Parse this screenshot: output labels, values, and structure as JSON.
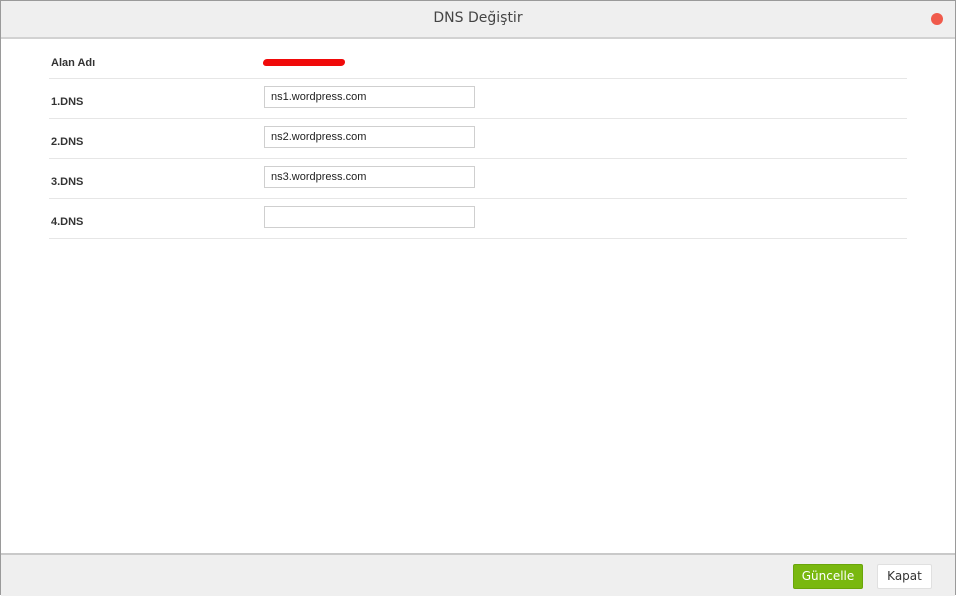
{
  "dialog": {
    "title": "DNS Değiştir"
  },
  "form": {
    "domain_label": "Alan Adı",
    "rows": [
      {
        "label": "1.DNS",
        "value": "ns1.wordpress.com"
      },
      {
        "label": "2.DNS",
        "value": "ns2.wordpress.com"
      },
      {
        "label": "3.DNS",
        "value": "ns3.wordpress.com"
      },
      {
        "label": "4.DNS",
        "value": ""
      }
    ]
  },
  "footer": {
    "update_label": "Güncelle",
    "close_label": "Kapat"
  },
  "colors": {
    "accent": "#79b80f",
    "close_dot": "#f05a4b",
    "redaction": "#f00a0a"
  }
}
